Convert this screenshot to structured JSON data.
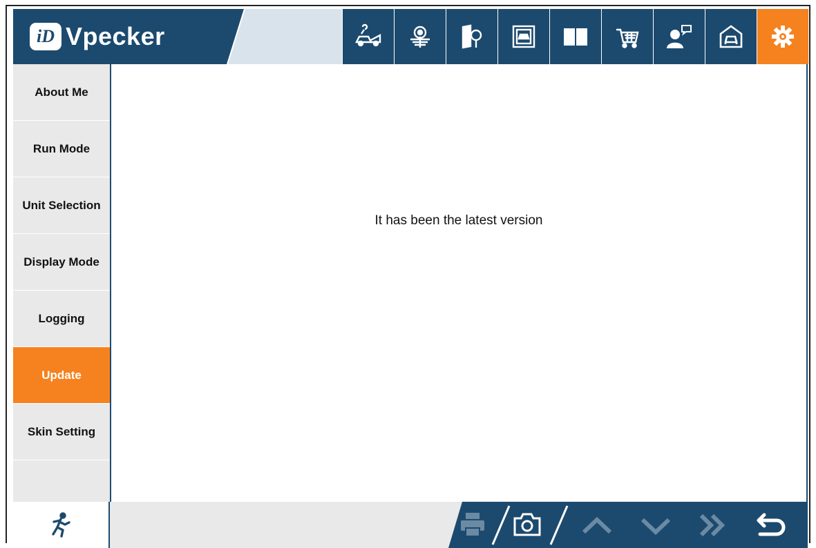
{
  "app": {
    "brand_mark": "iD",
    "brand_name": "Vpecker"
  },
  "toolbar": {
    "items": [
      {
        "icon": "car-repair-icon",
        "active": false
      },
      {
        "icon": "engine-service-icon",
        "active": false
      },
      {
        "icon": "manual-search-icon",
        "active": false
      },
      {
        "icon": "vehicle-info-icon",
        "active": false
      },
      {
        "icon": "book-icon",
        "active": false
      },
      {
        "icon": "shopping-cart-icon",
        "active": false
      },
      {
        "icon": "user-feedback-icon",
        "active": false
      },
      {
        "icon": "garage-icon",
        "active": false
      },
      {
        "icon": "gear-icon",
        "active": true
      }
    ]
  },
  "sidebar": {
    "items": [
      {
        "label": "About Me",
        "active": false
      },
      {
        "label": "Run Mode",
        "active": false
      },
      {
        "label": "Unit Selection",
        "active": false
      },
      {
        "label": "Display Mode",
        "active": false
      },
      {
        "label": "Logging",
        "active": false
      },
      {
        "label": "Update",
        "active": true
      },
      {
        "label": "Skin Setting",
        "active": false
      }
    ]
  },
  "main": {
    "message": "It has been the latest version"
  },
  "footer": {
    "icons": [
      "exit-run-icon",
      "print-icon",
      "camera-icon",
      "chevron-up-icon",
      "chevron-down-icon",
      "double-chevron-right-icon",
      "back-return-icon"
    ]
  },
  "colors": {
    "primary": "#1c4a6e",
    "accent": "#f5821f",
    "sidebar_bg": "#e9e9e9"
  }
}
